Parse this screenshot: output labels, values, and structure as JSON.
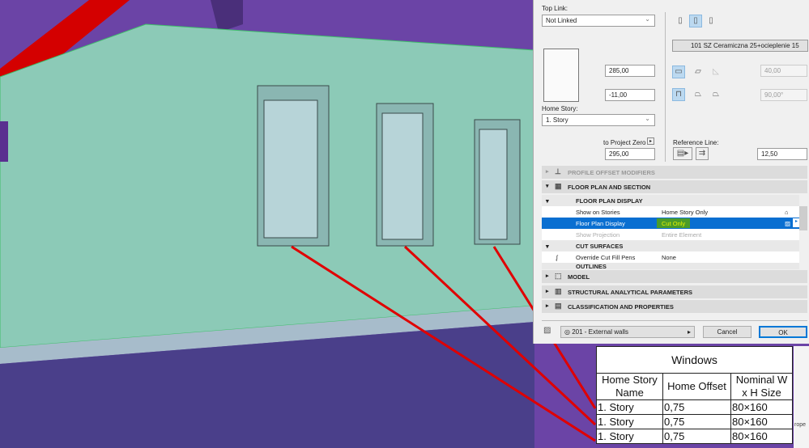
{
  "dialog": {
    "top_link_label": "Top Link:",
    "top_link_value": "Not Linked",
    "height_value": "285,00",
    "offset_value": "-11,00",
    "home_story_label": "Home Story:",
    "home_story_value": "1. Story",
    "to_project_zero_label": "to Project Zero",
    "project_zero_value": "295,00",
    "composite_name": "101 SZ Ceramiczna 25+ocieplenie 15",
    "thickness_value": "40,00",
    "angle_value": "90,00°",
    "reference_line_label": "Reference Line:",
    "ref_offset_value": "12,50",
    "sections": {
      "profile": "PROFILE OFFSET MODIFIERS",
      "floor_plan": "FLOOR PLAN AND SECTION",
      "model": "MODEL",
      "structural": "STRUCTURAL ANALYTICAL PARAMETERS",
      "classification": "CLASSIFICATION AND PROPERTIES"
    },
    "floor_plan_display_header": "FLOOR PLAN DISPLAY",
    "rows": [
      {
        "key": "Show on Stories",
        "value": "Home Story Only"
      },
      {
        "key": "Floor Plan Display",
        "value": "Cut Only"
      },
      {
        "key": "Show Projection",
        "value": "Entire Element"
      }
    ],
    "cut_surfaces_header": "CUT SURFACES",
    "override_row": {
      "key": "Override Cut Fill Pens",
      "value": "None"
    },
    "outlines_header": "OUTLINES",
    "layer": "201 - External walls",
    "cancel": "Cancel",
    "ok": "OK"
  },
  "schedule": {
    "title": "Windows",
    "headers": [
      "Home Story Name",
      "Home Offset",
      "Nominal W x H Size"
    ],
    "rows": [
      [
        "1. Story",
        "0,75",
        "80×160"
      ],
      [
        "1. Story",
        "0,75",
        "80×160"
      ],
      [
        "1. Story",
        "0,75",
        "80×160"
      ]
    ],
    "side_text": "rope"
  },
  "colors": {
    "roof": "#6b44a6",
    "wall": "#8ccab7",
    "selection": "#0078d7",
    "highlight": "#e6f000",
    "annotation": "#e00000"
  }
}
